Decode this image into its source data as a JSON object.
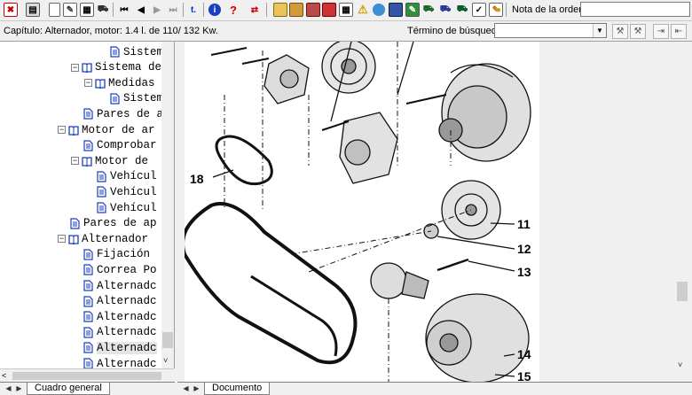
{
  "toolbar": {
    "order_label": "Nota de la orden:",
    "order_value": "",
    "buttons": [
      "exit-icon",
      "print-icon",
      "new-document-icon",
      "edit-note-icon",
      "clipboard-icon",
      "car-icon",
      "first-page-icon",
      "previous-page-icon",
      "next-page-icon",
      "last-page-icon",
      "top-icon",
      "info-icon",
      "help-icon",
      "switch-icon",
      "calculator-icon",
      "parts-icon",
      "engine-icon",
      "manual-icon",
      "table-icon",
      "warning-icon",
      "globe-icon",
      "save-icon",
      "wrench-icon",
      "vehicle-icon",
      "tools-icon",
      "truck-icon",
      "checklist-icon",
      "manual-edit-icon",
      "lightbulb-icon"
    ]
  },
  "status": {
    "chapter": "Capítulo: Alternador, motor: 1.4 l. de 110/ 132 Kw.",
    "search_label": "Término de búsqueda:",
    "search_value": ""
  },
  "tree": {
    "items": [
      {
        "label": "Sistema S",
        "indent": 3,
        "type": "doc"
      },
      {
        "label": "Sistema de ",
        "indent": 1,
        "type": "book",
        "expanded": true
      },
      {
        "label": "Medidas d",
        "indent": 2,
        "type": "book",
        "expanded": true
      },
      {
        "label": "Sistema",
        "indent": 3,
        "type": "doc"
      },
      {
        "label": "Pares de ap",
        "indent": 1,
        "type": "doc"
      },
      {
        "label": "Motor de ar",
        "indent": 0,
        "type": "book",
        "expanded": true
      },
      {
        "label": "Comprobar",
        "indent": 1,
        "type": "doc"
      },
      {
        "label": "Motor de ",
        "indent": 1,
        "type": "book",
        "expanded": true
      },
      {
        "label": "Vehícul",
        "indent": 2,
        "type": "doc"
      },
      {
        "label": "Vehícul",
        "indent": 2,
        "type": "doc"
      },
      {
        "label": "Vehícul",
        "indent": 2,
        "type": "doc"
      },
      {
        "label": "Pares de ap",
        "indent": 0,
        "type": "doc"
      },
      {
        "label": "Alternador ",
        "indent": 0,
        "type": "book",
        "expanded": true
      },
      {
        "label": "Fijación ",
        "indent": 1,
        "type": "doc"
      },
      {
        "label": "Correa Po",
        "indent": 1,
        "type": "doc"
      },
      {
        "label": "Alternadc",
        "indent": 1,
        "type": "doc"
      },
      {
        "label": "Alternadc",
        "indent": 1,
        "type": "doc"
      },
      {
        "label": "Alternadc",
        "indent": 1,
        "type": "doc"
      },
      {
        "label": "Alternadc",
        "indent": 1,
        "type": "doc"
      },
      {
        "label": "Alternadc",
        "indent": 1,
        "type": "doc",
        "selected": true
      },
      {
        "label": "Alternadc",
        "indent": 1,
        "type": "doc"
      }
    ]
  },
  "tabs": {
    "left": "Cuadro general",
    "right": "Documento"
  },
  "drawing": {
    "callouts": [
      "18",
      "11",
      "12",
      "13",
      "14",
      "15"
    ]
  }
}
